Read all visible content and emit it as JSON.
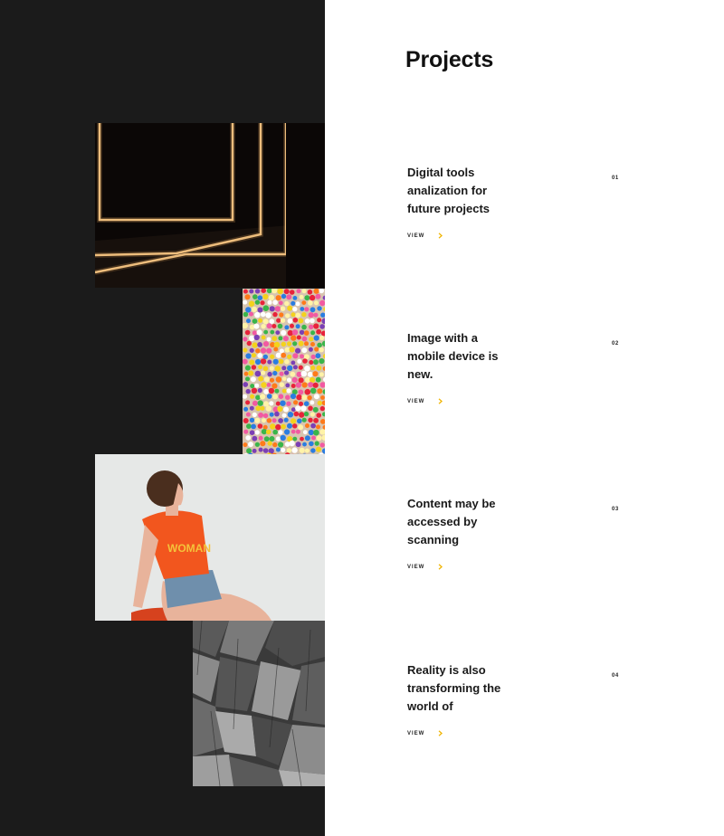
{
  "page": {
    "title": "Projects"
  },
  "colors": {
    "left_panel": "#1b1b1b",
    "accent": "#f0b400",
    "text": "#1a1a1a"
  },
  "projects": [
    {
      "title": "Digital tools analization for future projects",
      "number": "01",
      "link_label": "VIEW",
      "image": "neon-light-frames"
    },
    {
      "title": "Image with a mobile device is new.",
      "number": "02",
      "link_label": "VIEW",
      "image": "colorful-candy-beads"
    },
    {
      "title": "Content may be accessed by scanning",
      "number": "03",
      "link_label": "VIEW",
      "image": "woman-in-orange-tshirt"
    },
    {
      "title": "Reality is also transforming the world of",
      "number": "04",
      "link_label": "VIEW",
      "image": "gray-rock-texture"
    }
  ]
}
